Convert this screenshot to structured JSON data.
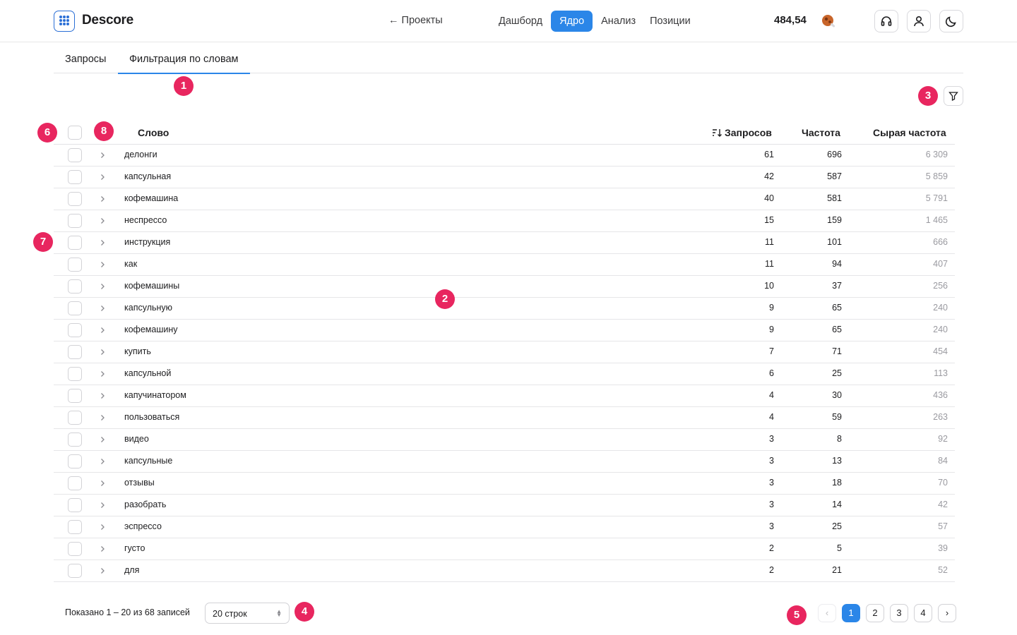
{
  "header": {
    "brand": "Descore",
    "back_link": "← Проекты",
    "nav": [
      "Дашборд",
      "Ядро",
      "Анализ",
      "Позиции"
    ],
    "active_nav": "Ядро",
    "balance": "484,54"
  },
  "tabs": [
    "Запросы",
    "Фильтрация по словам"
  ],
  "table": {
    "headers": {
      "word": "Слово",
      "requests": "Запросов",
      "frequency": "Частота",
      "raw_frequency": "Сырая частота"
    },
    "rows": [
      {
        "word": "делонги",
        "requests": "61",
        "frequency": "696",
        "raw": "6 309"
      },
      {
        "word": "капсульная",
        "requests": "42",
        "frequency": "587",
        "raw": "5 859"
      },
      {
        "word": "кофемашина",
        "requests": "40",
        "frequency": "581",
        "raw": "5 791"
      },
      {
        "word": "неспрессо",
        "requests": "15",
        "frequency": "159",
        "raw": "1 465"
      },
      {
        "word": "инструкция",
        "requests": "11",
        "frequency": "101",
        "raw": "666"
      },
      {
        "word": "как",
        "requests": "11",
        "frequency": "94",
        "raw": "407"
      },
      {
        "word": "кофемашины",
        "requests": "10",
        "frequency": "37",
        "raw": "256"
      },
      {
        "word": "капсульную",
        "requests": "9",
        "frequency": "65",
        "raw": "240"
      },
      {
        "word": "кофемашину",
        "requests": "9",
        "frequency": "65",
        "raw": "240"
      },
      {
        "word": "купить",
        "requests": "7",
        "frequency": "71",
        "raw": "454"
      },
      {
        "word": "капсульной",
        "requests": "6",
        "frequency": "25",
        "raw": "113"
      },
      {
        "word": "капучинатором",
        "requests": "4",
        "frequency": "30",
        "raw": "436"
      },
      {
        "word": "пользоваться",
        "requests": "4",
        "frequency": "59",
        "raw": "263"
      },
      {
        "word": "видео",
        "requests": "3",
        "frequency": "8",
        "raw": "92"
      },
      {
        "word": "капсульные",
        "requests": "3",
        "frequency": "13",
        "raw": "84"
      },
      {
        "word": "отзывы",
        "requests": "3",
        "frequency": "18",
        "raw": "70"
      },
      {
        "word": "разобрать",
        "requests": "3",
        "frequency": "14",
        "raw": "42"
      },
      {
        "word": "эспрессо",
        "requests": "3",
        "frequency": "25",
        "raw": "57"
      },
      {
        "word": "густо",
        "requests": "2",
        "frequency": "5",
        "raw": "39"
      },
      {
        "word": "для",
        "requests": "2",
        "frequency": "21",
        "raw": "52"
      }
    ]
  },
  "footer": {
    "shown": "Показано 1 – 20 из 68 записей",
    "rows_per_page": "20 строк",
    "pages": [
      "1",
      "2",
      "3",
      "4"
    ],
    "current_page": "1"
  },
  "badges": [
    "1",
    "2",
    "3",
    "4",
    "5",
    "6",
    "7",
    "8"
  ],
  "colors": {
    "accent": "#2b86e8",
    "badge": "#e8265f",
    "muted": "#9a9aa0"
  }
}
